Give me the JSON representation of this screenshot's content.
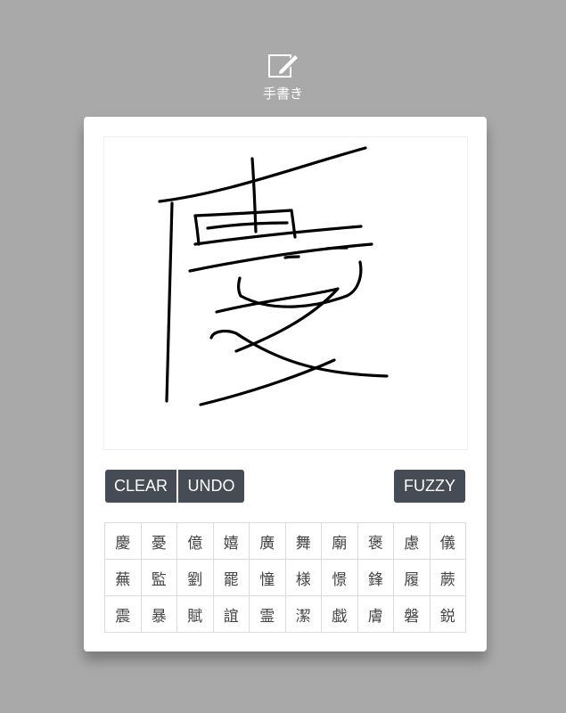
{
  "mode": {
    "label": "手書き",
    "icon": "handwriting-pen-icon"
  },
  "toolbar": {
    "clear_label": "CLEAR",
    "undo_label": "UNDO",
    "fuzzy_label": "FUZZY"
  },
  "colors": {
    "background": "#a9a9a9",
    "button": "#454c55",
    "ink": "#000000"
  },
  "candidates": [
    [
      "慶",
      "憂",
      "億",
      "嬉",
      "廣",
      "舞",
      "廟",
      "褒",
      "慮",
      "儀"
    ],
    [
      "蕪",
      "監",
      "劉",
      "罷",
      "憧",
      "様",
      "憬",
      "鋒",
      "履",
      "蕨"
    ],
    [
      "震",
      "暴",
      "賦",
      "誼",
      "霊",
      "潔",
      "戯",
      "膚",
      "磐",
      "鋭"
    ]
  ]
}
